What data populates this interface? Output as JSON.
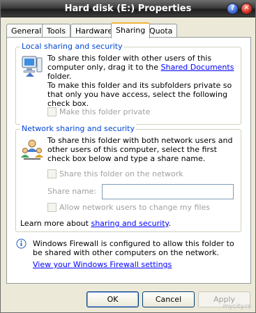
{
  "window": {
    "title": "Hard disk (E:) Properties",
    "help_glyph": "?",
    "close_glyph": "✕"
  },
  "tabs": [
    "General",
    "Tools",
    "Hardware",
    "Sharing",
    "Quota"
  ],
  "active_tab": "Sharing",
  "local": {
    "legend": "Local sharing and security",
    "text1_pre": "To share this folder with other users of this computer only, drag it to the ",
    "text1_link": "Shared Documents",
    "text1_post": " folder.",
    "text2": "To make this folder and its subfolders private so that only you have access, select the following check box.",
    "private_label": "Make this folder private"
  },
  "network": {
    "legend": "Network sharing and security",
    "text": "To share this folder with both network users and other users of this computer, select the first check box below and type a share name.",
    "share_label": "Share this folder on the network",
    "share_name_label": "Share name:",
    "share_name_value": "",
    "allow_label": "Allow network users to change my files",
    "learn_pre": "Learn more about ",
    "learn_link": "sharing and security",
    "learn_post": "."
  },
  "firewall": {
    "text": "Windows Firewall is configured to allow this folder to be shared with other computers on the network.",
    "link": "View your Windows Firewall settings"
  },
  "buttons": {
    "ok": "OK",
    "cancel": "Cancel",
    "apply": "Apply"
  },
  "watermark": "mycity.rs"
}
